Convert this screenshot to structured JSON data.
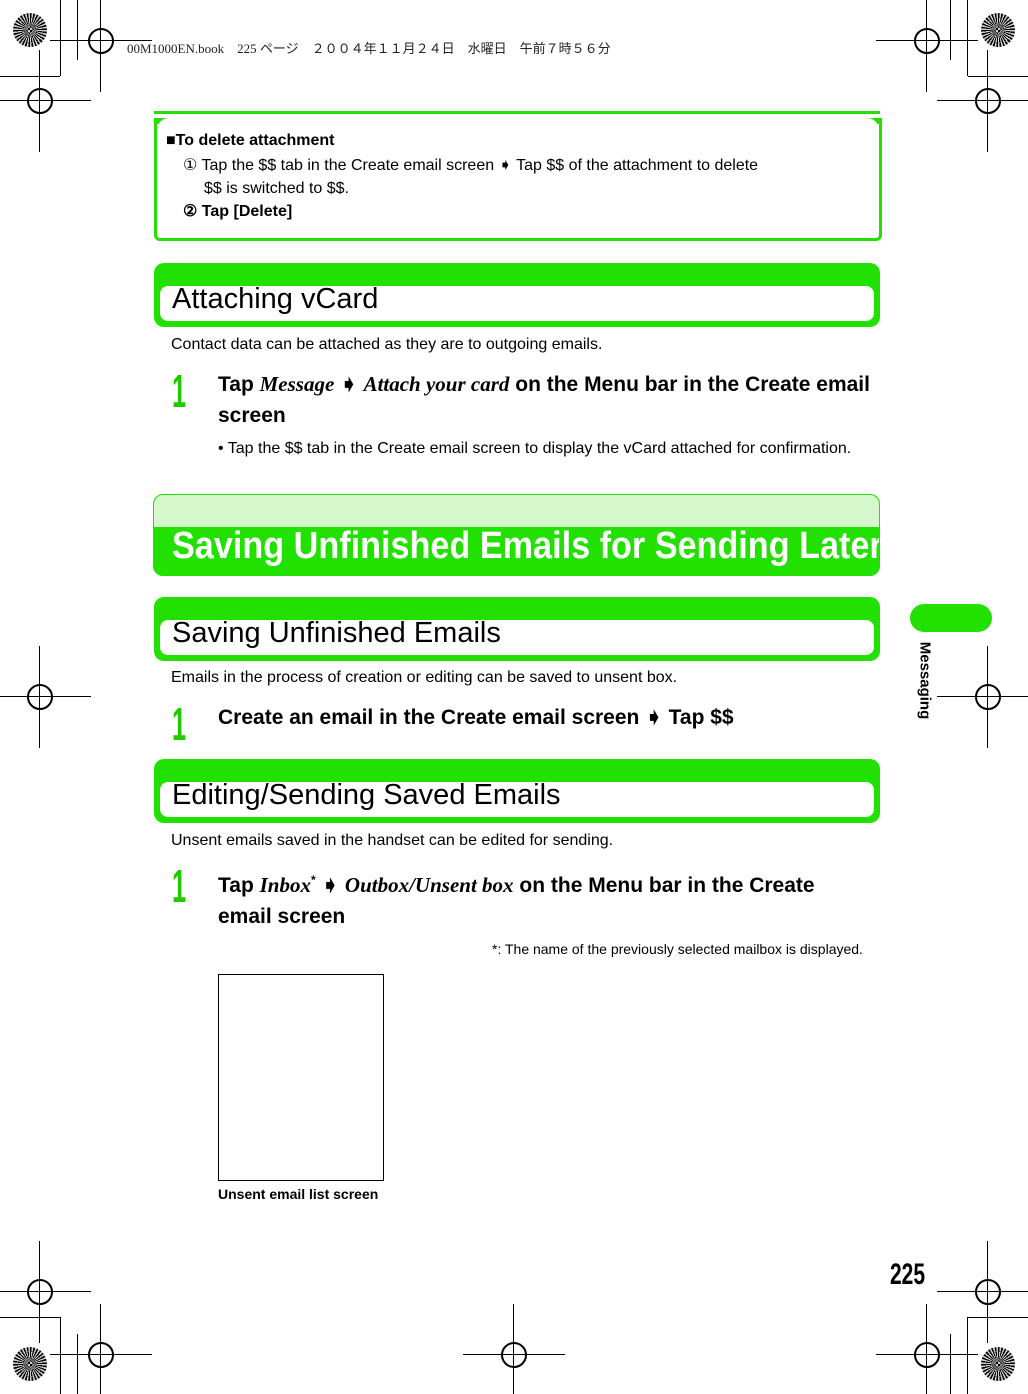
{
  "header": {
    "print_line": "00M1000EN.book　225 ページ　２００４年１１月２４日　水曜日　午前７時５６分"
  },
  "note": {
    "title": "■To delete attachment",
    "steps": [
      {
        "num": "①",
        "text": "Tap the $$ tab in the Create email screen ➧ Tap $$ of the attachment to delete",
        "sub": "$$ is switched to $$."
      },
      {
        "num": "②",
        "text": "Tap [Delete]"
      }
    ]
  },
  "vcard": {
    "heading": "Attaching vCard",
    "intro": "Contact data can be attached as they are to outgoing emails.",
    "step_num": "1",
    "step_pre": "Tap ",
    "step_i1": "Message",
    "step_arrow": " ➧ ",
    "step_i2": "Attach your card",
    "step_post": " on the Menu bar in the Create email",
    "step_line2": "screen",
    "bullet": "•   Tap the $$ tab in the Create email screen to display the vCard attached for confirmation."
  },
  "chapter": {
    "title": "Saving Unfinished Emails for Sending Later"
  },
  "saving": {
    "heading": "Saving Unfinished Emails",
    "intro": "Emails in the process of creation or editing can be saved to unsent box.",
    "step_num": "1",
    "step": "Create an email in the Create email screen ➧ Tap $$"
  },
  "editing": {
    "heading": "Editing/Sending Saved Emails",
    "intro": "Unsent emails saved in the handset can be edited for sending.",
    "step_num": "1",
    "step_pre": "Tap ",
    "step_i1": "Inbox",
    "step_sup": "*",
    "step_arrow": " ➧ ",
    "step_i2": "Outbox/Unsent box",
    "step_post": " on the Menu bar in the Create",
    "step_line2": "email screen",
    "footnote": "*: The name of the previously selected mailbox is displayed.",
    "caption": "Unsent email list screen"
  },
  "side_tab": {
    "label": "Messaging"
  },
  "page_number": "225",
  "colors": {
    "accent": "#22e000",
    "light_accent": "#d4f7cc"
  }
}
